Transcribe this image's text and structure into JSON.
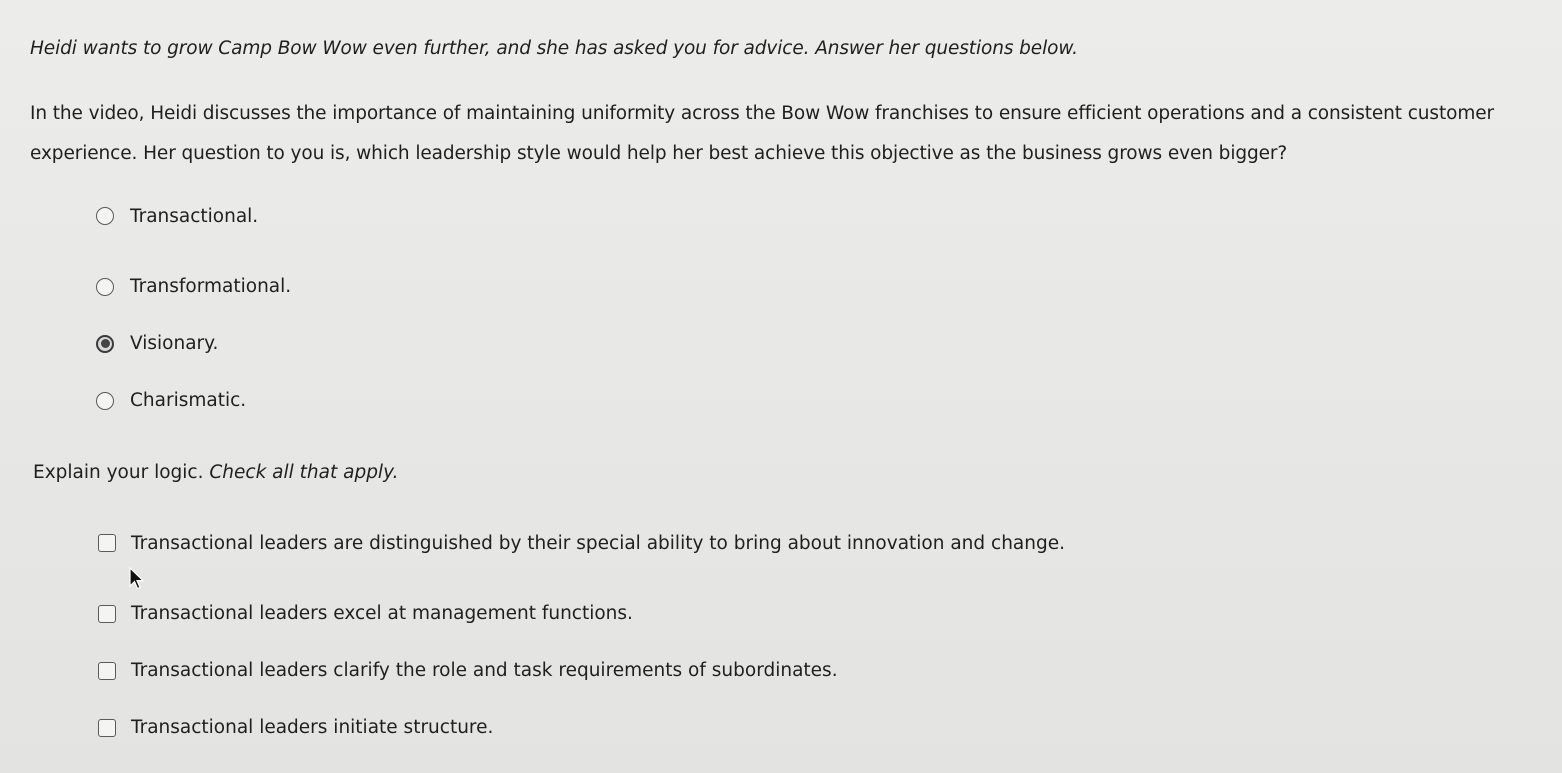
{
  "prompt": {
    "intro": "Heidi wants to grow Camp Bow Wow even further, and she has asked you for advice. Answer her questions below.",
    "question": "In the video, Heidi discusses the importance of maintaining uniformity across the Bow Wow franchises to ensure efficient operations and a consistent customer experience. Her question to you is, which leadership style would help her best achieve this objective as the business grows even bigger?"
  },
  "options": [
    {
      "label": "Transactional.",
      "selected": false
    },
    {
      "label": "Transformational.",
      "selected": false
    },
    {
      "label": "Visionary.",
      "selected": true
    },
    {
      "label": "Charismatic.",
      "selected": false
    }
  ],
  "explain": {
    "label": "Explain your logic.",
    "instruction": "Check all that apply."
  },
  "checks": [
    {
      "label": "Transactional leaders are distinguished by their special ability to bring about innovation and change.",
      "checked": false
    },
    {
      "label": "Transactional leaders excel at management functions.",
      "checked": false
    },
    {
      "label": "Transactional leaders clarify the role and task requirements of subordinates.",
      "checked": false
    },
    {
      "label": "Transactional leaders initiate structure.",
      "checked": false
    }
  ],
  "icons": {
    "radio_unselected": "radio-empty-icon",
    "radio_selected": "radio-filled-icon",
    "checkbox": "checkbox-empty-icon",
    "cursor": "mouse-pointer-icon"
  }
}
